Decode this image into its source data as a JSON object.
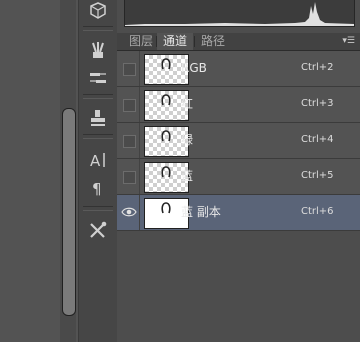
{
  "tools": [
    {
      "icon": "cube-icon"
    },
    {
      "icon": "brushes-icon"
    },
    {
      "icon": "brush-preset-icon"
    },
    {
      "icon": "clone-stamp-icon"
    },
    {
      "icon": "character-icon"
    },
    {
      "icon": "paragraph-icon"
    },
    {
      "icon": "tools-icon"
    }
  ],
  "tabs": [
    {
      "label": "图层",
      "active": false
    },
    {
      "label": "通道",
      "active": true
    },
    {
      "label": "路径",
      "active": false
    }
  ],
  "panel_menu_icon": "panel-menu-icon",
  "channels": [
    {
      "name": "RGB",
      "shortcut": "Ctrl+2",
      "visible": false,
      "selected": false
    },
    {
      "name": "红",
      "shortcut": "Ctrl+3",
      "visible": false,
      "selected": false
    },
    {
      "name": "绿",
      "shortcut": "Ctrl+4",
      "visible": false,
      "selected": false
    },
    {
      "name": "蓝",
      "shortcut": "Ctrl+5",
      "visible": false,
      "selected": false
    },
    {
      "name": "蓝 副本",
      "shortcut": "Ctrl+6",
      "visible": true,
      "selected": true
    }
  ],
  "colors": {
    "selected_row": "#5a6478",
    "panel_bg": "#535353"
  }
}
